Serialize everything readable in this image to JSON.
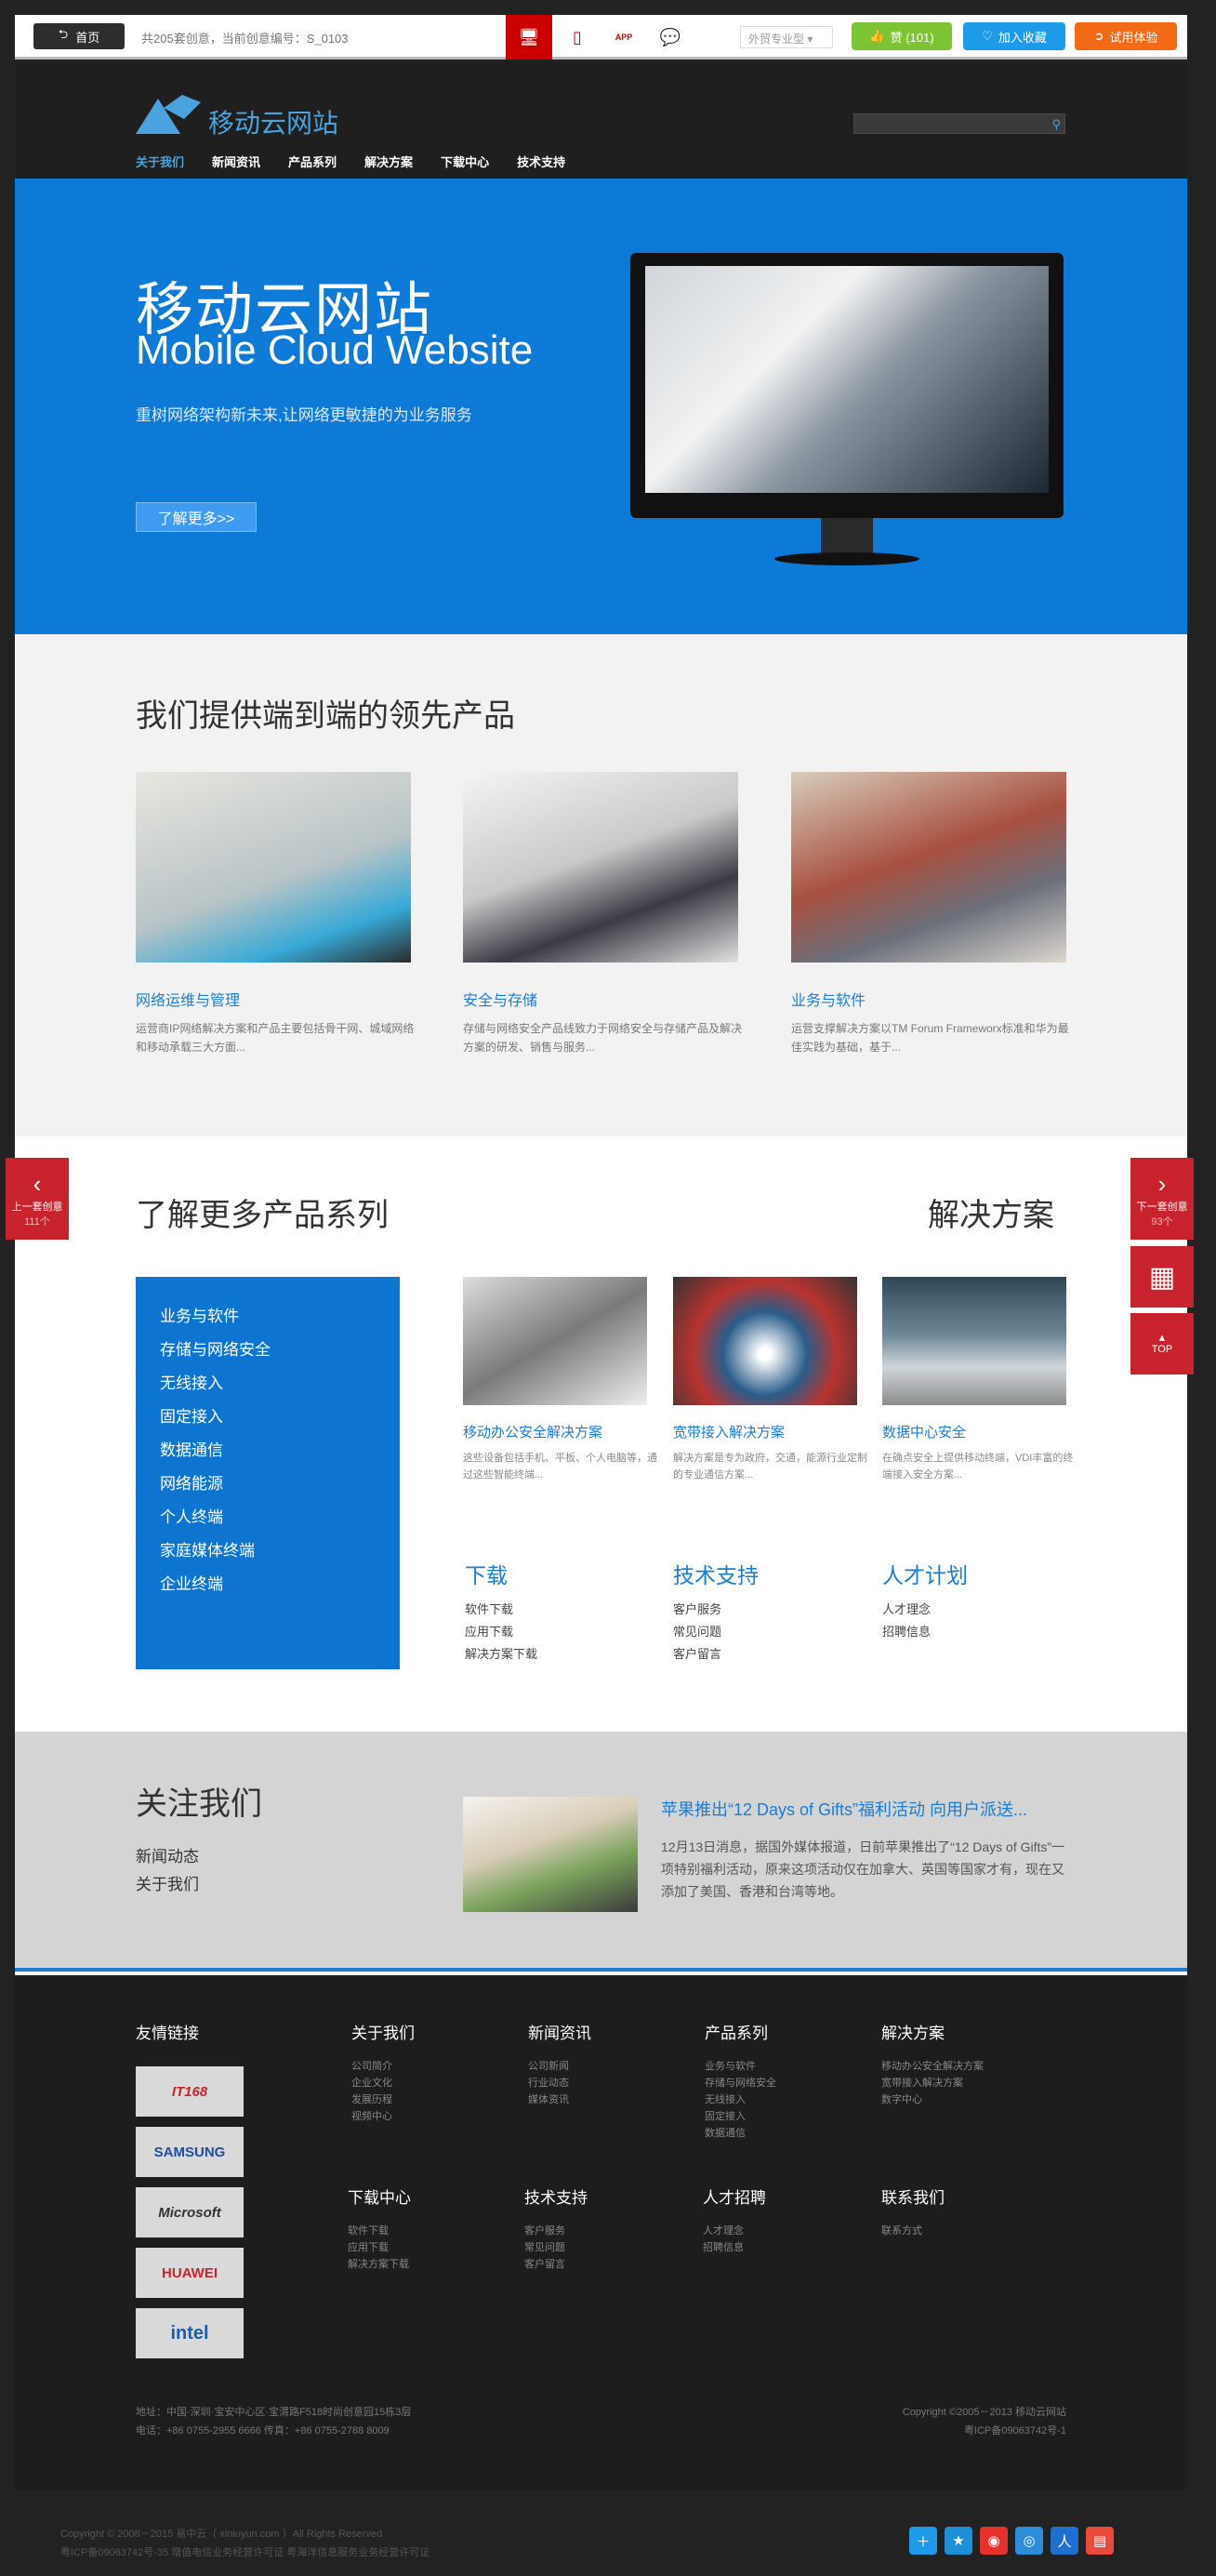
{
  "topbar": {
    "home_label": "首页",
    "count_text": "共205套创意，当前创意编号：S_0103",
    "select_value": "外贸专业型",
    "like_label": "赞 (101)",
    "fav_label": "加入收藏",
    "trial_label": "试用体验"
  },
  "site": {
    "logo_text": "移动云网站",
    "nav": [
      "关于我们",
      "新闻资讯",
      "产品系列",
      "解决方案",
      "下载中心",
      "技术支持"
    ],
    "banner": {
      "title": "移动云网站",
      "subtitle": "Mobile Cloud Website",
      "tagline": "重树网络架构新未来,让网络更敏捷的为业务服务",
      "button": "了解更多>>"
    },
    "products_heading": "我们提供端到端的领先产品",
    "products": [
      {
        "title": "网络运维与管理",
        "desc": "运营商IP网络解决方案和产品主要包括骨干网、城域网络和移动承载三大方面..."
      },
      {
        "title": "安全与存储",
        "desc": "存储与网络安全产品线致力于网络安全与存储产品及解决方案的研发、销售与服务..."
      },
      {
        "title": "业务与软件",
        "desc": "运营支撑解决方案以TM Forum Frameworx标准和华为最佳实践为基础，基于..."
      }
    ],
    "series_heading": "了解更多产品系列",
    "solutions_heading": "解决方案",
    "categories": [
      "业务与软件",
      "存储与网络安全",
      "无线接入",
      "固定接入",
      "数据通信",
      "网络能源",
      "个人终端",
      "家庭媒体终端",
      "企业终端"
    ],
    "solutions": [
      {
        "title": "移动办公安全解决方案",
        "desc": "这些设备包括手机、平板、个人电脑等，通过这些智能终端..."
      },
      {
        "title": "宽带接入解决方案",
        "desc": "解决方案是专为政府，交通，能源行业定制的专业通信方案..."
      },
      {
        "title": "数据中心安全",
        "desc": "在确点安全上提供移动终端，VDI丰富的终端接入安全方案..."
      }
    ],
    "links": [
      {
        "title": "下载",
        "items": [
          "软件下载",
          "应用下载",
          "解决方案下载"
        ]
      },
      {
        "title": "技术支持",
        "items": [
          "客户服务",
          "常见问题",
          "客户留言"
        ]
      },
      {
        "title": "人才计划",
        "items": [
          "人才理念",
          "招聘信息"
        ]
      }
    ],
    "follow": {
      "heading": "关注我们",
      "items": [
        "新闻动态",
        "关于我们"
      ],
      "news_title": "苹果推出“12 Days of Gifts”福利活动 向用户派送...",
      "news_body": "12月13日消息，据国外媒体报道，日前苹果推出了“12 Days of Gifts”一项特别福利活动，原来这项活动仅在加拿大、英国等国家才有，现在又添加了美国、香港和台湾等地。"
    },
    "footer": {
      "friend_links": "友情链接",
      "partners": [
        "IT168",
        "SAMSUNG",
        "Microsoft",
        "HUAWEI",
        "intel"
      ],
      "cols": [
        {
          "title": "关于我们",
          "items": [
            "公司简介",
            "企业文化",
            "发展历程",
            "视频中心"
          ]
        },
        {
          "title": "新闻资讯",
          "items": [
            "公司新闻",
            "行业动态",
            "媒体资讯"
          ]
        },
        {
          "title": "产品系列",
          "items": [
            "业务与软件",
            "存储与网络安全",
            "无线接入",
            "固定接入",
            "数据通信"
          ]
        },
        {
          "title": "解决方案",
          "items": [
            "移动办公安全解决方案",
            "宽带接入解决方案",
            "数字中心"
          ]
        },
        {
          "title": "下载中心",
          "items": [
            "软件下载",
            "应用下载",
            "解决方案下载"
          ]
        },
        {
          "title": "技术支持",
          "items": [
            "客户服务",
            "常见问题",
            "客户留言"
          ]
        },
        {
          "title": "人才招聘",
          "items": [
            "人才理念",
            "招聘信息"
          ]
        },
        {
          "title": "联系我们",
          "items": [
            "联系方式"
          ]
        }
      ],
      "address": "地址：中国·深圳·宝安中心区·宝渭路F518时尚创意园15栋3层",
      "phone": "电话：+86 0755-2955 6666    传真：+86 0755-2788 8009",
      "copyright": "Copyright ©2005－2013 移动云网站",
      "icp": "粤ICP备09063742号-1"
    }
  },
  "side": {
    "prev_label": "上一套创意",
    "prev_count": "111个",
    "next_label": "下一套创意",
    "next_count": "93个",
    "top_label": "TOP"
  },
  "bottom": {
    "line1": "Copyright © 2008－2015 易中云（ xiniuyun.com ）All Rights Reserved",
    "line2": "粤ICP备09063742号-35 增值电信业务经营许可证 粤海洋信息服务业务经营许可证"
  },
  "colors": {
    "accent": "#0e7ad8",
    "red": "#c8232c",
    "dark": "#1f1f1f"
  }
}
